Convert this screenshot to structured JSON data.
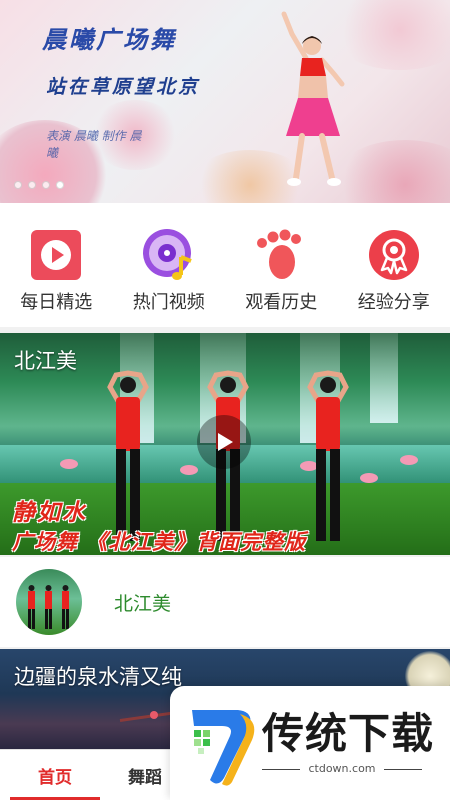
{
  "banner": {
    "title": "晨曦广场舞",
    "subtitle": "站在草原望北京",
    "credit": "表演  晨曦 制作  晨曦",
    "dots": 4,
    "active_dot": 4
  },
  "quick_nav": [
    {
      "label": "每日精选",
      "icon": "play-icon",
      "color": "#ec4b5b"
    },
    {
      "label": "热门视频",
      "icon": "music-disc-icon",
      "color": "#9a4fe0"
    },
    {
      "label": "观看历史",
      "icon": "footprint-icon",
      "color": "#f0565a"
    },
    {
      "label": "经验分享",
      "icon": "ribbon-badge-icon",
      "color": "#ec3f4a"
    }
  ],
  "featured_video": {
    "title": "北江美",
    "caption_line1": "静如水",
    "caption_line2": "广场舞 《北江美》背面完整版"
  },
  "author_row": {
    "name": "北江美"
  },
  "second_video": {
    "title": "边疆的泉水清又纯"
  },
  "tabs": [
    {
      "label": "首页",
      "active": true
    },
    {
      "label": "舞蹈",
      "active": false
    }
  ],
  "watermark": {
    "text": "传统下载",
    "url": "ctdown.com"
  }
}
